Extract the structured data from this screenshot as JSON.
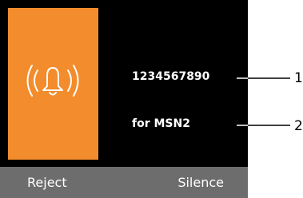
{
  "incoming_call": {
    "caller_number": "1234567890",
    "msn_label": "for MSN2"
  },
  "softkeys": {
    "left_label": "Reject",
    "right_label": "Silence"
  },
  "callouts": [
    {
      "label": "1"
    },
    {
      "label": "2"
    }
  ],
  "colors": {
    "icon_panel": "#f28c2c",
    "screen_background": "#000000",
    "softkey_bar": "#6d6d6d",
    "text": "#ffffff"
  },
  "icons": {
    "ringing": "ringing-bell-icon"
  }
}
